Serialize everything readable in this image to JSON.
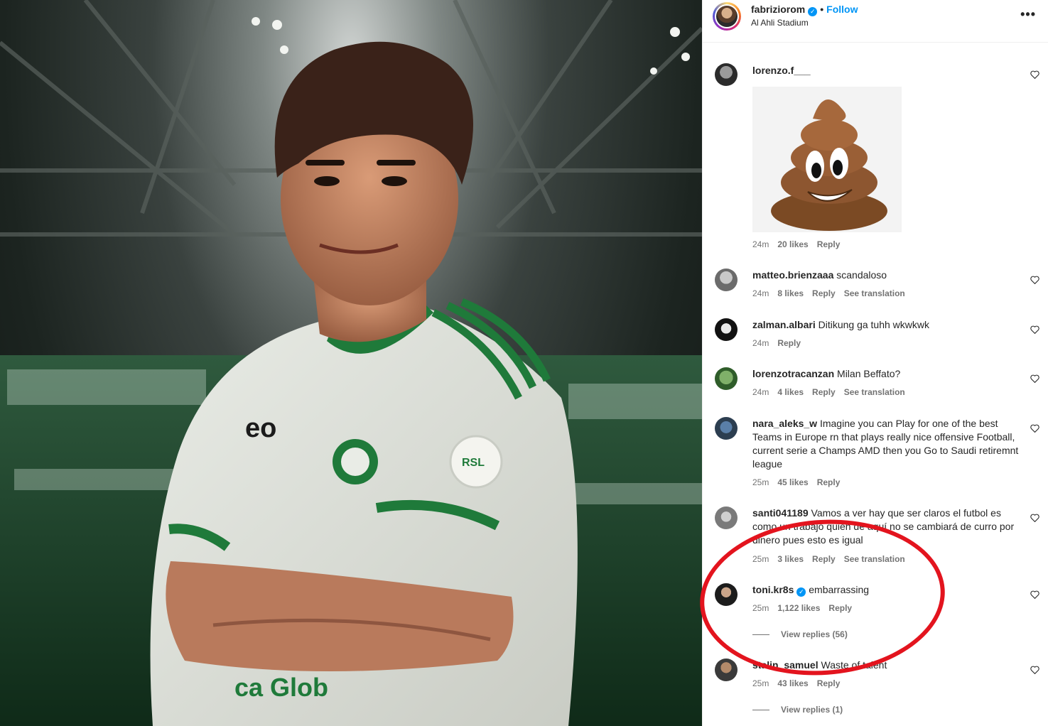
{
  "post": {
    "username": "fabriziorom",
    "follow_label": "Follow",
    "location": "Al Ahli Stadium",
    "more_icon": "more-horizontal-icon",
    "jersey_texts": [
      "eo",
      "RSL",
      "ca Glob"
    ]
  },
  "comments": [
    {
      "username": "lorenzo.f___",
      "text": "",
      "time": "24m",
      "likes": "20 likes",
      "reply": "Reply",
      "translation": "",
      "verified": false,
      "sticker": "poop-emoji-icon"
    },
    {
      "username": "matteo.brienzaaa",
      "text": "scandaloso",
      "time": "24m",
      "likes": "8 likes",
      "reply": "Reply",
      "translation": "See translation",
      "verified": false
    },
    {
      "username": "zalman.albari",
      "text": "Ditikung ga tuhh wkwkwk",
      "time": "24m",
      "likes": "",
      "reply": "Reply",
      "translation": "",
      "verified": false
    },
    {
      "username": "lorenzotracanzan",
      "text": "Milan Beffato?",
      "time": "24m",
      "likes": "4 likes",
      "reply": "Reply",
      "translation": "See translation",
      "verified": false
    },
    {
      "username": "nara_aleks_w",
      "text": "Imagine you can Play for one of the best Teams in Europe rn that plays really nice offensive Football, current serie a Champs AMD then you Go to Saudi retiremnt league",
      "time": "25m",
      "likes": "45 likes",
      "reply": "Reply",
      "translation": "",
      "verified": false
    },
    {
      "username": "santi041189",
      "text": "Vamos a ver hay que ser claros el futbol es como un trabajo quien de aquí no se cambiará de curro por dinero pues esto es igual",
      "time": "25m",
      "likes": "3 likes",
      "reply": "Reply",
      "translation": "See translation",
      "verified": false
    },
    {
      "username": "toni.kr8s",
      "text": "embarrassing",
      "time": "25m",
      "likes": "1,122 likes",
      "reply": "Reply",
      "translation": "",
      "verified": true,
      "view_replies": "View replies (56)"
    },
    {
      "username": "stalin_samuel",
      "text": "Waste of talent",
      "time": "25m",
      "likes": "43 likes",
      "reply": "Reply",
      "translation": "",
      "verified": false,
      "view_replies": "View replies (1)"
    }
  ],
  "colors": {
    "accent": "#0095f6",
    "highlight_ring": "#e3141e",
    "kit_green": "#1f7a3a"
  }
}
